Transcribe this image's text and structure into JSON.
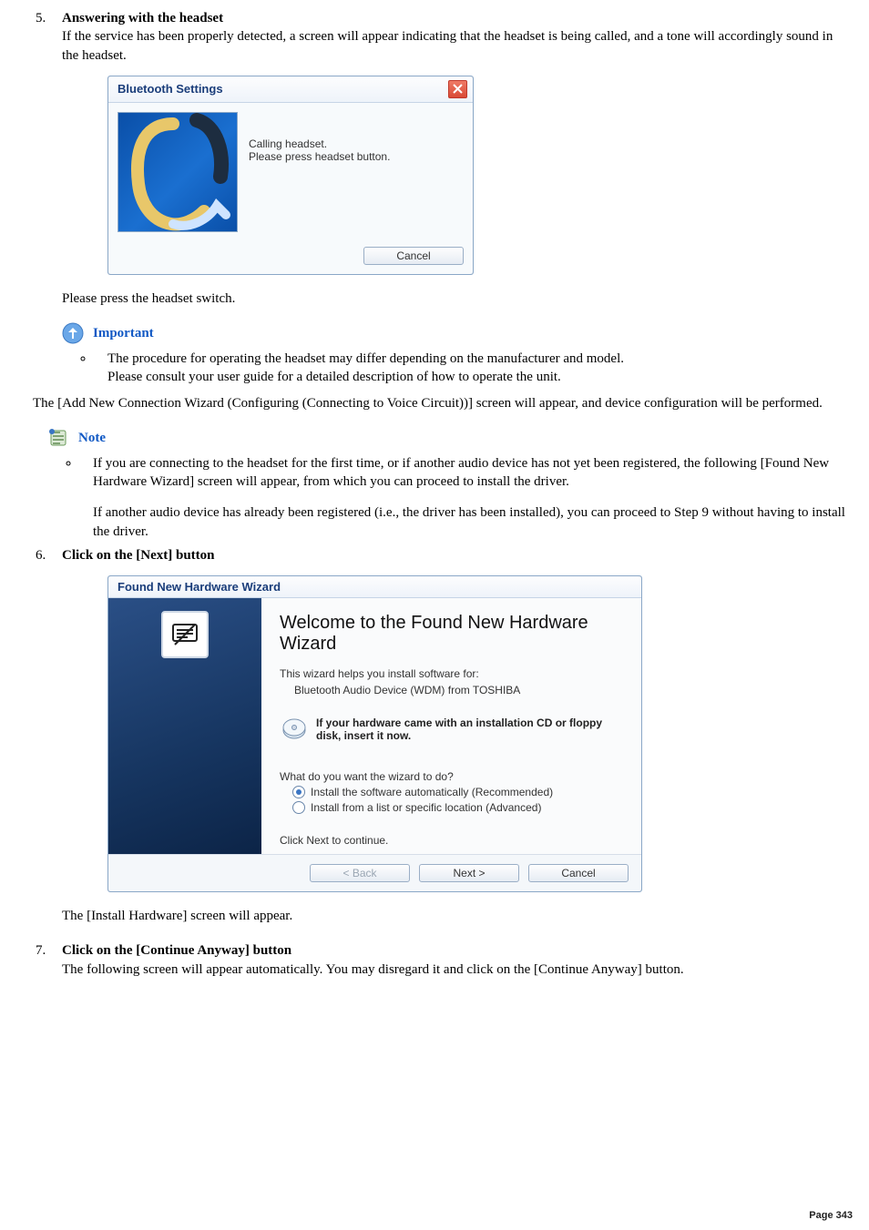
{
  "steps": {
    "s5": {
      "title": "Answering with the headset",
      "text": "If the service has been properly detected, a screen will appear indicating that the headset is being called, and a tone will accordingly sound in the headset.",
      "after_dialog": "Please press the headset switch."
    },
    "s6": {
      "title": "Click on the [Next] button",
      "after_dialog": "The [Install Hardware] screen will appear."
    },
    "s7": {
      "title": "Click on the [Continue Anyway] button",
      "text": "The following screen will appear automatically. You may disregard it and click on the [Continue Anyway] button."
    }
  },
  "important": {
    "label": "Important",
    "bullet_a": "The procedure for operating the headset may differ depending on the manufacturer and model.",
    "bullet_b": "Please consult your user guide for a detailed description of how to operate the unit."
  },
  "mid_para": "The [Add New Connection Wizard (Configuring (Connecting to Voice Circuit))] screen will appear, and device configuration will be performed.",
  "note": {
    "label": "Note",
    "bullet_a": "If you are connecting to the headset for the first time, or if another audio device has not yet been registered, the following [Found New Hardware Wizard] screen will appear, from which you can proceed to install the driver.",
    "bullet_b": "If another audio device has already been registered (i.e., the driver has been installed), you can proceed to Step 9 without having to install the driver."
  },
  "dialog1": {
    "title": "Bluetooth Settings",
    "msg1": "Calling headset.",
    "msg2": "Please press headset button.",
    "cancel": "Cancel"
  },
  "dialog2": {
    "title": "Found New Hardware Wizard",
    "heading": "Welcome to the Found New Hardware Wizard",
    "line1": "This wizard helps you install software for:",
    "line2": "Bluetooth Audio Device (WDM) from TOSHIBA",
    "cd": "If your hardware came with an installation CD or floppy disk, insert it now.",
    "prompt": "What do you want the wizard to do?",
    "opt1": "Install the software automatically (Recommended)",
    "opt2": "Install from a list or specific location (Advanced)",
    "cont": "Click Next to continue.",
    "back": "< Back",
    "next": "Next >",
    "cancel": "Cancel"
  },
  "footer": "Page 343"
}
